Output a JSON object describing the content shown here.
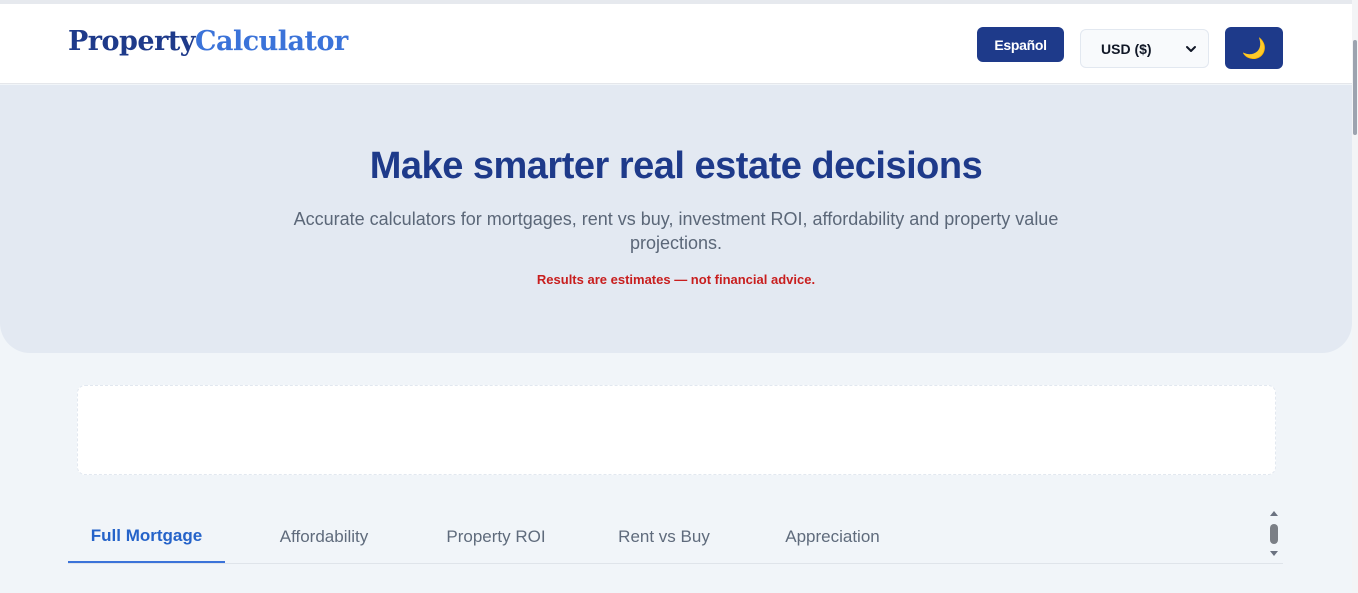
{
  "header": {
    "logo_part1": "Property",
    "logo_part2": "Calculator",
    "language_button": "Español",
    "currency_select": "USD ($)",
    "theme_toggle_icon": "moon-icon"
  },
  "hero": {
    "title": "Make smarter real estate decisions",
    "subtitle": "Accurate calculators for mortgages, rent vs buy, investment ROI, affordability and property value projections.",
    "disclaimer": "Results are estimates — not financial advice."
  },
  "tabs": [
    {
      "label": "Full Mortgage",
      "active": true
    },
    {
      "label": "Affordability",
      "active": false
    },
    {
      "label": "Property ROI",
      "active": false
    },
    {
      "label": "Rent vs Buy",
      "active": false
    },
    {
      "label": "Appreciation",
      "active": false
    }
  ],
  "colors": {
    "brand_dark": "#1e3a8a",
    "brand_light": "#3b73d9",
    "warning": "#c81e1e",
    "hero_bg": "#e3e9f2",
    "page_bg": "#f1f5f9"
  }
}
